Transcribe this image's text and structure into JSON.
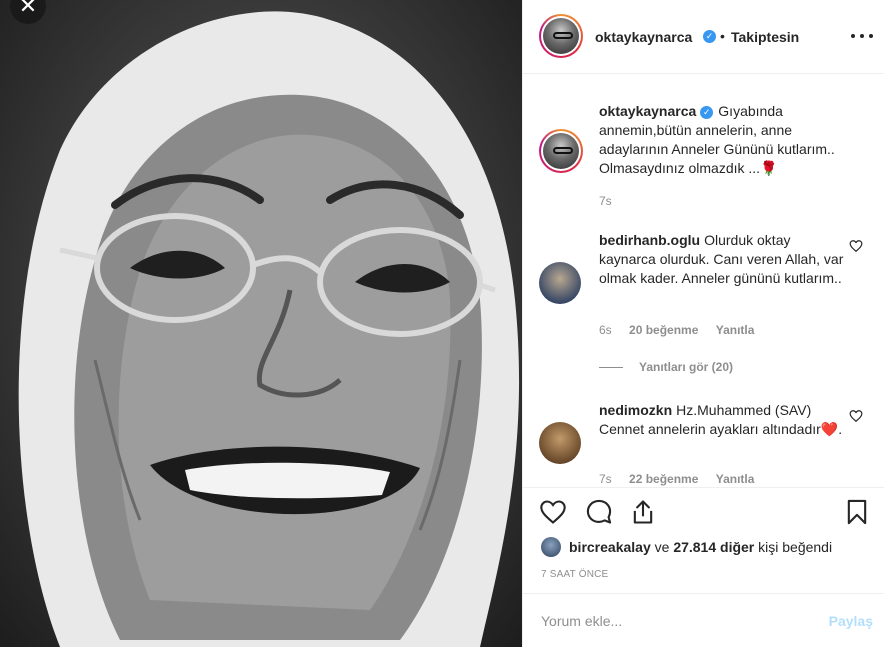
{
  "close_glyph": "✕",
  "header": {
    "username": "oktaykaynarca",
    "verified_glyph": "✓",
    "separator": "•",
    "follow_status": "Takiptesin"
  },
  "caption": {
    "username": "oktaykaynarca",
    "text": "Gıyabında annemin,bütün annelerin, anne adaylarının Anneler Gününü kutlarım.. Olmasaydınız olmazdık ...🌹",
    "time": "7s"
  },
  "comments": [
    {
      "username": "bedirhanb.oglu",
      "text": "Olurduk oktay kaynarca olurduk. Canı veren Allah, var olmak kader. Anneler gününü kutlarım..",
      "time": "6s",
      "likes": "20 beğenme",
      "reply": "Yanıtla",
      "view_replies": "Yanıtları gör (20)"
    },
    {
      "username": "nedimozkn",
      "text": "Hz.Muhammed (SAV) Cennet annelerin ayakları altındadır❤️.",
      "time": "7s",
      "likes": "22 beğenme",
      "reply": "Yanıtla"
    }
  ],
  "likes": {
    "user": "bircreakalay",
    "connector": "ve",
    "count": "27.814 diğer",
    "suffix": "kişi beğendi"
  },
  "timestamp": "7 SAAT ÖNCE",
  "add_comment": {
    "placeholder": "Yorum ekle...",
    "post_label": "Paylaş"
  },
  "colors": {
    "accent": "#3897f0",
    "post_disabled": "#b2dffc",
    "meta_text": "#8e8e8e",
    "heart": "#ed4956"
  }
}
